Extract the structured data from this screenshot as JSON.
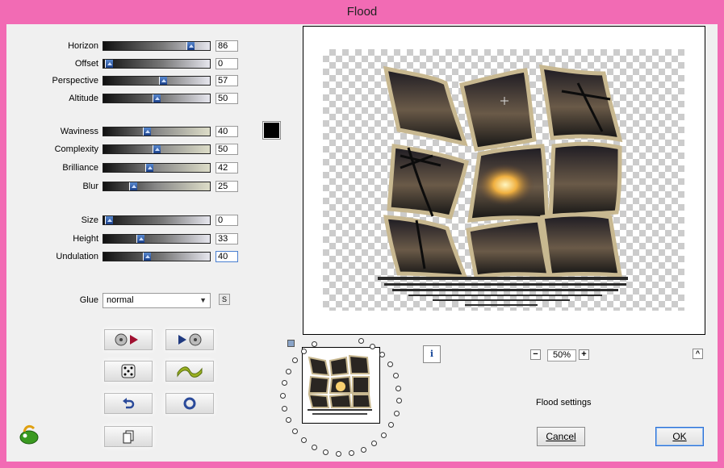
{
  "title": "Flood",
  "sliders": [
    {
      "label": "Horizon",
      "value": "86",
      "style": "dark"
    },
    {
      "label": "Offset",
      "value": "0",
      "style": "dark"
    },
    {
      "label": "Perspective",
      "value": "57",
      "style": "dark"
    },
    {
      "label": "Altitude",
      "value": "50",
      "style": "dark"
    },
    {
      "label": "Waviness",
      "value": "40",
      "style": "sand"
    },
    {
      "label": "Complexity",
      "value": "50",
      "style": "sand"
    },
    {
      "label": "Brilliance",
      "value": "42",
      "style": "sand"
    },
    {
      "label": "Blur",
      "value": "25",
      "style": "sand"
    },
    {
      "label": "Size",
      "value": "0",
      "style": "dark"
    },
    {
      "label": "Height",
      "value": "33",
      "style": "dark"
    },
    {
      "label": "Undulation",
      "value": "40",
      "style": "dark"
    }
  ],
  "color_swatch": "#000000",
  "glue": {
    "label": "Glue",
    "value": "normal",
    "side_button": "S"
  },
  "icons": {
    "load": "disc-play-icon",
    "save": "play-disc-icon",
    "random": "dice-icon",
    "wave": "wave-icon",
    "reset": "undo-arrow-icon",
    "default": "circle-icon",
    "copy": "copy-pages-icon",
    "logo": "leaf-logo-icon"
  },
  "zoom": {
    "minus": "−",
    "value": "50%",
    "plus": "+"
  },
  "info_label": "i",
  "collapse_label": "^",
  "status": "Flood settings",
  "buttons": {
    "cancel": "Cancel",
    "ok": "OK"
  }
}
